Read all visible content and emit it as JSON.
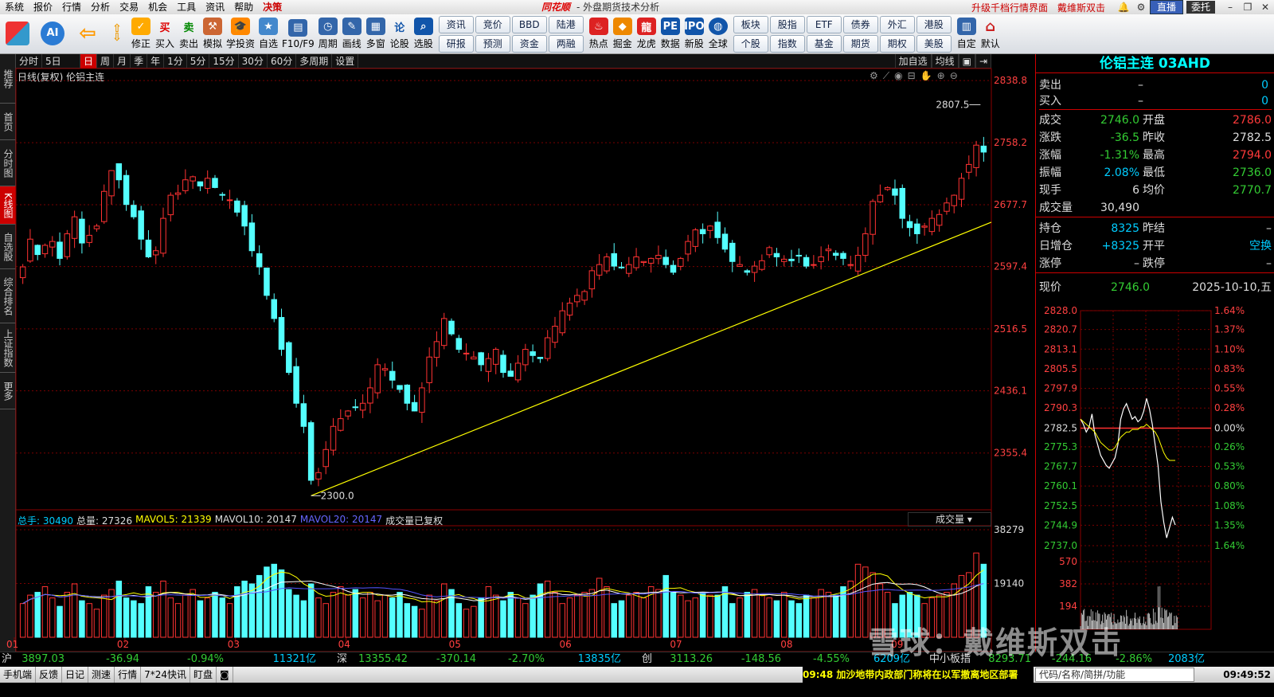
{
  "menu": [
    "系统",
    "报价",
    "行情",
    "分析",
    "交易",
    "机会",
    "工具",
    "资讯",
    "帮助",
    "决策"
  ],
  "app": {
    "brand": "同花顺",
    "subtitle": "- 外盘期货技术分析",
    "link_upgrade": "升级千档行情界面",
    "link_user": "戴维斯双击",
    "btn_live": "直播",
    "btn_trust": "委托"
  },
  "toolbar": {
    "buttons": [
      "修正",
      "买入",
      "卖出",
      "模拟",
      "学投资",
      "自选",
      "F10/F9",
      "周期",
      "画线",
      "多窗",
      "论股",
      "选股"
    ],
    "grid": [
      "资讯",
      "研报",
      "竞价",
      "预测",
      "BBD",
      "资金",
      "陆港",
      "两融"
    ],
    "buttons2": [
      "热点",
      "掘金",
      "龙虎",
      "数据",
      "新股",
      "全球"
    ],
    "grid2": [
      "板块",
      "个股",
      "股指",
      "指数",
      "ETF",
      "基金",
      "债券",
      "期货",
      "外汇",
      "期权",
      "港股",
      "美股"
    ],
    "buttons3": [
      "自定",
      "默认"
    ]
  },
  "leftbar": [
    "推荐",
    "首页",
    "分时图",
    "K线图",
    "自选股",
    "综合排名",
    "上证指数",
    "更多"
  ],
  "periods": [
    "分时",
    "5日",
    "日",
    "周",
    "月",
    "季",
    "年",
    "1分",
    "5分",
    "15分",
    "30分",
    "60分",
    "多周期",
    "设置"
  ],
  "period_right": [
    "加自选",
    "均线"
  ],
  "chart_title": "日线(复权) 伦铝主连",
  "vol_legend": {
    "total": "总手: 30490",
    "total_vol": "总量: 27326",
    "ma5": "MAVOL5: 21339",
    "ma10": "MAVOL10: 20147",
    "ma20": "MAVOL20: 20147",
    "note": "成交量已复权",
    "selector": "成交量"
  },
  "chart_data": {
    "type": "candlestick",
    "title": "伦铝主连",
    "price_axis": [
      "2838.8",
      "2758.2",
      "2677.7",
      "2597.4",
      "2516.5",
      "2436.1",
      "2355.4"
    ],
    "ylim": [
      2290,
      2840
    ],
    "volume_axis": [
      "38279",
      "19140"
    ],
    "months": [
      "01",
      "02",
      "03",
      "04",
      "05",
      "06",
      "07",
      "08",
      "09"
    ],
    "annotations": {
      "high": "2807.5",
      "low": "2300.0"
    },
    "trendline": [
      [
        2300,
        2000
      ],
      [
        2655,
        2000
      ]
    ],
    "closes": [
      2597,
      2633,
      2613,
      2625,
      2630,
      2608,
      2640,
      2662,
      2628,
      2638,
      2650,
      2695,
      2722,
      2710,
      2678,
      2662,
      2633,
      2610,
      2618,
      2660,
      2690,
      2693,
      2710,
      2714,
      2702,
      2712,
      2700,
      2690,
      2684,
      2668,
      2650,
      2618,
      2597,
      2560,
      2530,
      2490,
      2460,
      2420,
      2390,
      2320,
      2330,
      2360,
      2390,
      2400,
      2410,
      2415,
      2420,
      2440,
      2470,
      2465,
      2450,
      2438,
      2420,
      2410,
      2440,
      2480,
      2500,
      2530,
      2510,
      2490,
      2485,
      2480,
      2470,
      2478,
      2490,
      2460,
      2455,
      2472,
      2490,
      2482,
      2478,
      2505,
      2520,
      2540,
      2550,
      2560,
      2565,
      2592,
      2600,
      2610,
      2598,
      2596,
      2600,
      2610,
      2604,
      2608,
      2612,
      2600,
      2590,
      2608,
      2630,
      2645,
      2640,
      2650,
      2635,
      2620,
      2604,
      2600,
      2590,
      2598,
      2605,
      2622,
      2610,
      2607,
      2605,
      2612,
      2598,
      2600,
      2610,
      2620,
      2612,
      2608,
      2600,
      2612,
      2640,
      2682,
      2690,
      2700,
      2690,
      2660,
      2648,
      2640,
      2650,
      2660,
      2665,
      2680,
      2690,
      2712,
      2730,
      2755,
      2746
    ],
    "volumes": [
      12000,
      15000,
      16000,
      18000,
      14000,
      11000,
      16000,
      19000,
      13000,
      12000,
      10000,
      15000,
      17000,
      20000,
      14000,
      13000,
      12000,
      18000,
      16000,
      20000,
      14000,
      12000,
      15000,
      17000,
      13000,
      14000,
      16000,
      14000,
      12000,
      18000,
      20000,
      19000,
      22000,
      25000,
      26000,
      24000,
      17000,
      15000,
      13000,
      19000,
      14000,
      12000,
      16000,
      18000,
      15000,
      17000,
      14000,
      16000,
      13000,
      15000,
      14000,
      16000,
      12000,
      11000,
      10000,
      15000,
      13000,
      19000,
      17000,
      12000,
      10000,
      11000,
      14000,
      18000,
      15000,
      13000,
      16000,
      14000,
      12000,
      15000,
      19000,
      20000,
      16000,
      12000,
      14000,
      15000,
      16000,
      17000,
      21000,
      18000,
      12000,
      13000,
      15000,
      16000,
      14000,
      18000,
      17000,
      22000,
      16000,
      15000,
      13000,
      14000,
      16000,
      15000,
      15000,
      18000,
      12000,
      14000,
      16000,
      17000,
      15000,
      14000,
      13000,
      16000,
      13000,
      12000,
      15000,
      14000,
      17000,
      16000,
      15000,
      18000,
      20000,
      26000,
      25000,
      23000,
      19000,
      16000,
      12000,
      15000,
      16000,
      15000,
      12000,
      14000,
      15000,
      16000,
      19000,
      22000,
      23000,
      30000,
      26000
    ]
  },
  "quote": {
    "title": "伦铝主连 03AHD",
    "sell": {
      "label": "卖出",
      "price": "–",
      "vol": "0"
    },
    "buy": {
      "label": "买入",
      "price": "–",
      "vol": "0"
    },
    "rows": [
      {
        "l1": "成交",
        "v1": "2746.0",
        "l2": "开盘",
        "v2": "2786.0"
      },
      {
        "l1": "涨跌",
        "v1": "-36.5",
        "l2": "昨收",
        "v2": "2782.5"
      },
      {
        "l1": "涨幅",
        "v1": "-1.31%",
        "l2": "最高",
        "v2": "2794.0"
      },
      {
        "l1": "振幅",
        "v1": "2.08%",
        "l2": "最低",
        "v2": "2736.0"
      },
      {
        "l1": "现手",
        "v1": "6",
        "l2": "均价",
        "v2": "2770.7"
      },
      {
        "l1": "成交量",
        "v1": "30,490",
        "l2": "",
        "v2": ""
      },
      {
        "l1": "持仓",
        "v1": "8325",
        "l2": "昨结",
        "v2": "–"
      },
      {
        "l1": "日增仓",
        "v1": "+8325",
        "l2": "开平",
        "v2": "空换"
      },
      {
        "l1": "涨停",
        "v1": "–",
        "l2": "跌停",
        "v2": "–"
      }
    ],
    "now_label": "现价",
    "now_price": "2746.0",
    "date": "2025-10-10,五"
  },
  "intraday": {
    "price_axis": [
      "2828.0",
      "2820.7",
      "2813.1",
      "2805.5",
      "2797.9",
      "2790.3",
      "2782.5",
      "2775.3",
      "2767.7",
      "2760.1",
      "2752.5",
      "2744.9",
      "2737.0"
    ],
    "pct_axis": [
      "1.64%",
      "1.37%",
      "1.10%",
      "0.83%",
      "0.55%",
      "0.28%",
      "0.00%",
      "0.26%",
      "0.53%",
      "0.80%",
      "1.08%",
      "1.35%",
      "1.64%"
    ],
    "vol_axis": [
      "570",
      "382",
      "194"
    ],
    "prices": [
      2786,
      2784,
      2781,
      2783,
      2788,
      2780,
      2776,
      2772,
      2770,
      2768,
      2767,
      2769,
      2771,
      2776,
      2786,
      2790,
      2792,
      2789,
      2786,
      2787,
      2785,
      2786,
      2789,
      2794,
      2790,
      2784,
      2776,
      2768,
      2754,
      2746,
      2740,
      2744,
      2748,
      2745
    ],
    "avg": [
      2786,
      2785,
      2784,
      2783,
      2782,
      2781,
      2779,
      2777,
      2776,
      2775,
      2774,
      2774,
      2775,
      2777,
      2779,
      2780,
      2781,
      2781,
      2782,
      2782,
      2782,
      2783,
      2783,
      2784,
      2783,
      2782,
      2781,
      2779,
      2776,
      2773,
      2771,
      2770,
      2770,
      2770
    ]
  },
  "status": {
    "sh_label": "沪",
    "sh_v": "3897.03",
    "sh_c": "-36.94",
    "sh_p": "-0.94%",
    "sh_a": "11321亿",
    "sz_label": "深",
    "sz_v": "13355.42",
    "sz_c": "-370.14",
    "sz_p": "-2.70%",
    "sz_a": "13835亿",
    "cy_label": "创",
    "cy_v": "3113.26",
    "cy_c": "-148.56",
    "cy_p": "-4.55%",
    "cy_a": "6209亿",
    "zx_label": "中小板指",
    "zx_v": "8293.71",
    "zx_c": "-244.16",
    "zx_p": "-2.86%",
    "zx_a": "2083亿"
  },
  "taskbar": {
    "items": [
      "手机端",
      "反馈",
      "日记",
      "测速",
      "行情",
      "7*24快讯",
      "盯盘"
    ],
    "news": "09:48 加沙地带内政部门称将在以军撤离地区部署",
    "search": "代码/名称/简拼/功能",
    "clock": "09:49:52"
  },
  "watermark": "雪球：戴维斯双击"
}
